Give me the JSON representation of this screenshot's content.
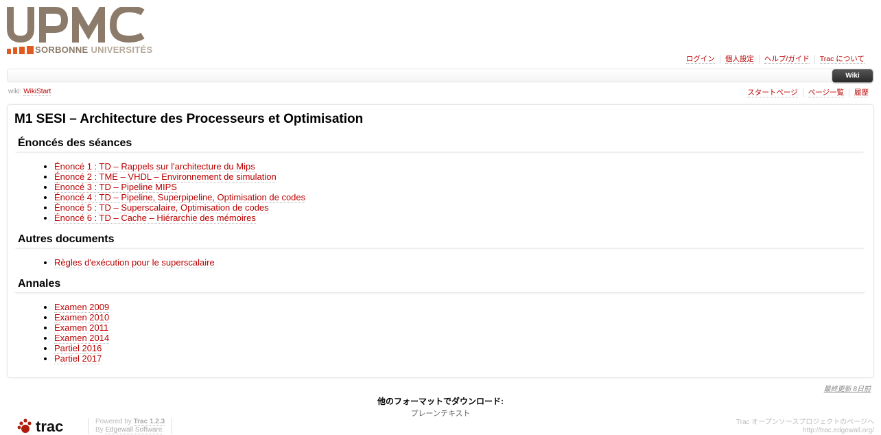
{
  "logo": {
    "text": "UPMC",
    "sub_a": "SORBONNE",
    "sub_b": "UNIVERSITÉS",
    "brand_color": "#8c7b6a",
    "accent_color": "#e05a22"
  },
  "metanav": {
    "login": "ログイン",
    "prefs": "個人設定",
    "help": "ヘルプ/ガイド",
    "about": "Trac について"
  },
  "mainnav": {
    "wiki_tab": "Wiki"
  },
  "breadcrumb": {
    "prefix": "wiki:",
    "page": "WikiStart"
  },
  "ctxtnav": {
    "start": "スタートページ",
    "index": "ページ一覧",
    "history": "履歴"
  },
  "content": {
    "title": "M1 SESI – Architecture des Processeurs et Optimisation",
    "sections": [
      {
        "heading": "Énoncés des séances",
        "items": [
          "Énoncé 1 : TD – Rappels sur l'architecture du Mips",
          "Énoncé 2 : TME – VHDL – Environnement de simulation",
          "Énoncé 3 : TD – Pipeline MIPS",
          "Énoncé 4 : TD – Pipeline, Superpipeline, Optimisation de codes",
          "Énoncé 5 : TD – Superscalaire, Optimisation de codes",
          "Énoncé 6 : TD – Cache – Hiérarchie des mémoires"
        ]
      },
      {
        "heading": "Autres documents",
        "items": [
          "Règles d'exécution pour le superscalaire"
        ]
      },
      {
        "heading": "Annales",
        "items": [
          "Examen 2009",
          "Examen 2010",
          "Examen 2011",
          "Examen 2014",
          "Partiel 2016",
          "Partiel 2017"
        ]
      }
    ]
  },
  "footer": {
    "last_modified": "最終更新 8日前",
    "altlinks_heading": "他のフォーマットでダウンロード:",
    "plain_text": "プレーンテキスト",
    "trac_logo_text": "trac",
    "powered_by": "Powered by",
    "trac_version": "Trac 1.2.3",
    "by": "By",
    "edgewall": "Edgewall Software",
    "right_line1": "Trac オープンソースプロジェクトのページへ",
    "right_line2": "http://trac.edgewall.org/"
  }
}
